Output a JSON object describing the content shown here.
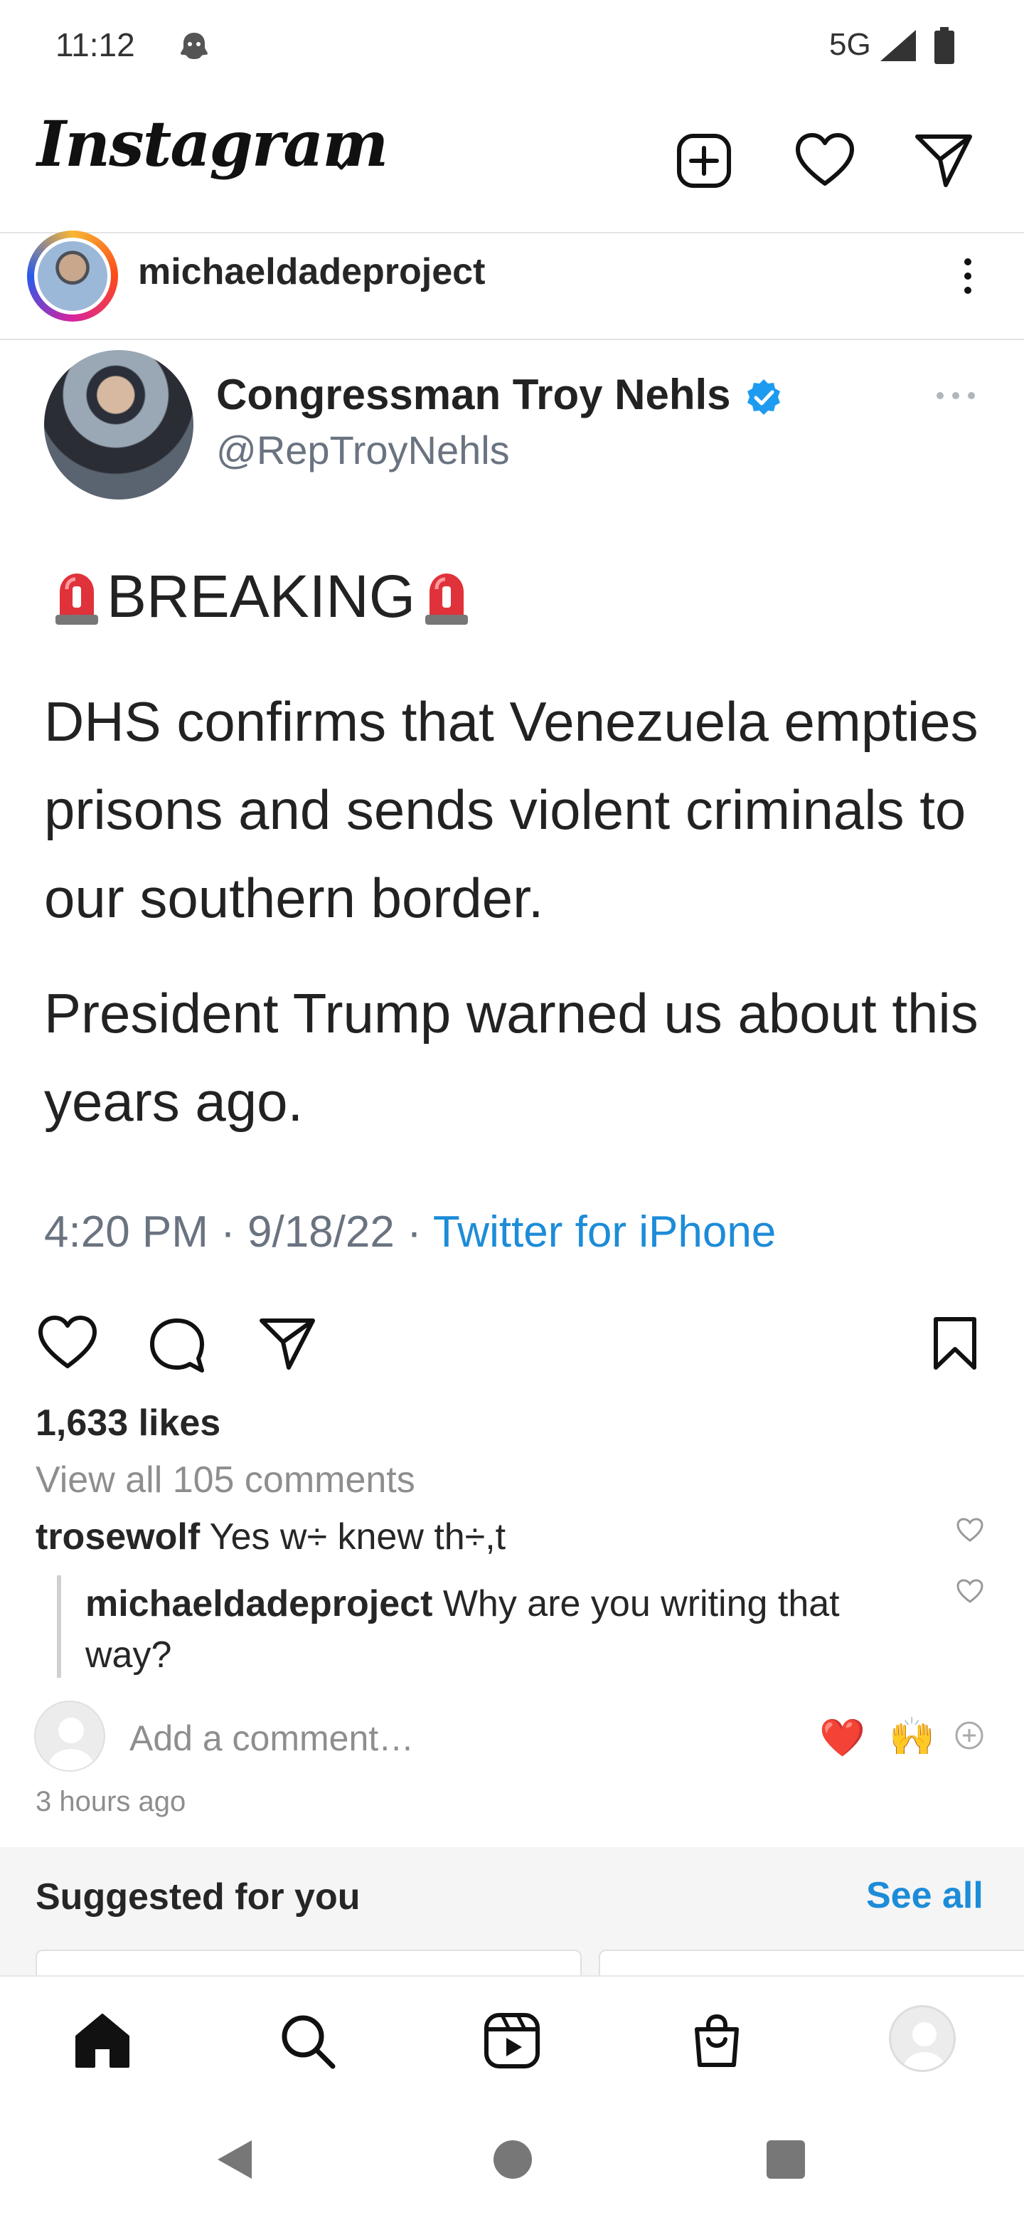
{
  "status_bar": {
    "time": "11:12",
    "network": "5G"
  },
  "header": {
    "logo_text": "Instagram",
    "icons": [
      "chevron-down-icon",
      "add-post-icon",
      "heart-icon",
      "direct-message-icon"
    ]
  },
  "post": {
    "username": "michaeldadeproject",
    "tweet": {
      "display_name": "Congressman Troy Nehls",
      "handle": "@RepTroyNehls",
      "headline": "BREAKING",
      "body_paragraph_1": "DHS confirms that Venezuela empties prisons and sends violent criminals to our southern border.",
      "body_paragraph_2": "President Trump warned us about this years ago.",
      "timestamp": "4:20 PM · 9/18/22 · ",
      "source": "Twitter for iPhone"
    },
    "likes": "1,633 likes",
    "view_comments": "View all 105 comments",
    "comments": [
      {
        "user": "trosewolf",
        "text": "Yes w÷ knew th÷,t"
      },
      {
        "user": "michaeldadeproject",
        "text": "Why are you writing that way?"
      }
    ],
    "add_comment_placeholder": "Add a comment…",
    "quick_emojis": [
      "❤️",
      "🙌"
    ],
    "time_ago": "3 hours ago"
  },
  "suggested": {
    "title": "Suggested for you",
    "see_all": "See all"
  },
  "colors": {
    "link_blue": "#1d8cd8",
    "verified_blue": "#1d9bf0",
    "text_dark": "#262626",
    "text_muted": "#8e8e8e"
  }
}
